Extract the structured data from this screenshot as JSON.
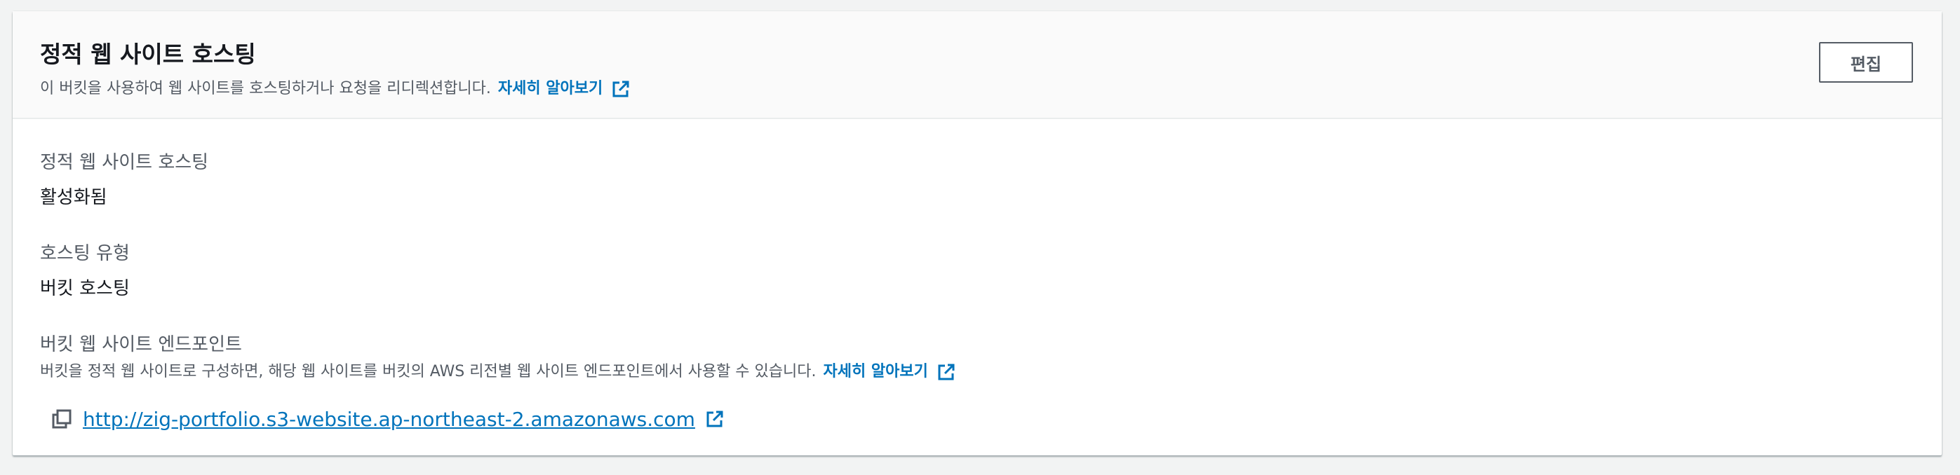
{
  "header": {
    "title": "정적 웹 사이트 호스팅",
    "description": "이 버킷을 사용하여 웹 사이트를 호스팅하거나 요청을 리디렉션합니다.",
    "learn_more": "자세히 알아보기",
    "edit_label": "편집"
  },
  "fields": {
    "static_hosting_label": "정적 웹 사이트 호스팅",
    "static_hosting_value": "활성화됨",
    "hosting_type_label": "호스팅 유형",
    "hosting_type_value": "버킷 호스팅",
    "endpoint_label": "버킷 웹 사이트 엔드포인트",
    "endpoint_desc": "버킷을 정적 웹 사이트로 구성하면, 해당 웹 사이트를 버킷의 AWS 리전별 웹 사이트 엔드포인트에서 사용할 수 있습니다.",
    "endpoint_learn_more": "자세히 알아보기",
    "endpoint_url": "http://zig-portfolio.s3-website.ap-northeast-2.amazonaws.com"
  },
  "icons": {
    "external": "external-link-icon",
    "copy": "copy-icon"
  },
  "colors": {
    "link": "#0073bb",
    "text": "#16191f",
    "secondary_text": "#545b64",
    "page_bg": "#f2f3f3"
  }
}
